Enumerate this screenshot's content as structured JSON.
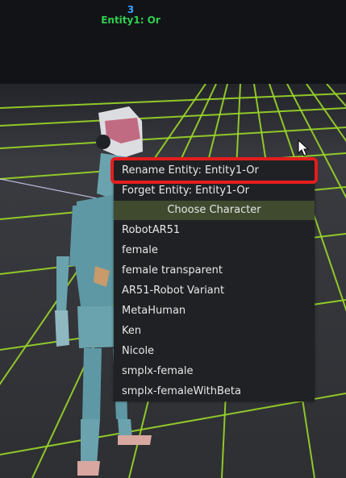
{
  "hud": {
    "entity_count": "3",
    "entity_name": "Entity1: Or"
  },
  "context_menu": {
    "rename_label": "Rename Entity: Entity1-Or",
    "forget_label": "Forget Entity: Entity1-Or",
    "section_header": "Choose Character",
    "characters": [
      "RobotAR51",
      "female",
      "female transparent",
      "AR51-Robot Variant",
      "MetaHuman",
      "Ken",
      "Nicole",
      "smplx-female",
      "smplx-femaleWithBeta"
    ],
    "highlight_color": "#e31d1d",
    "header_color": "#3f4a2e"
  },
  "scene": {
    "grid_color": "#a8e62a",
    "robot_color": "#5e98a4"
  }
}
